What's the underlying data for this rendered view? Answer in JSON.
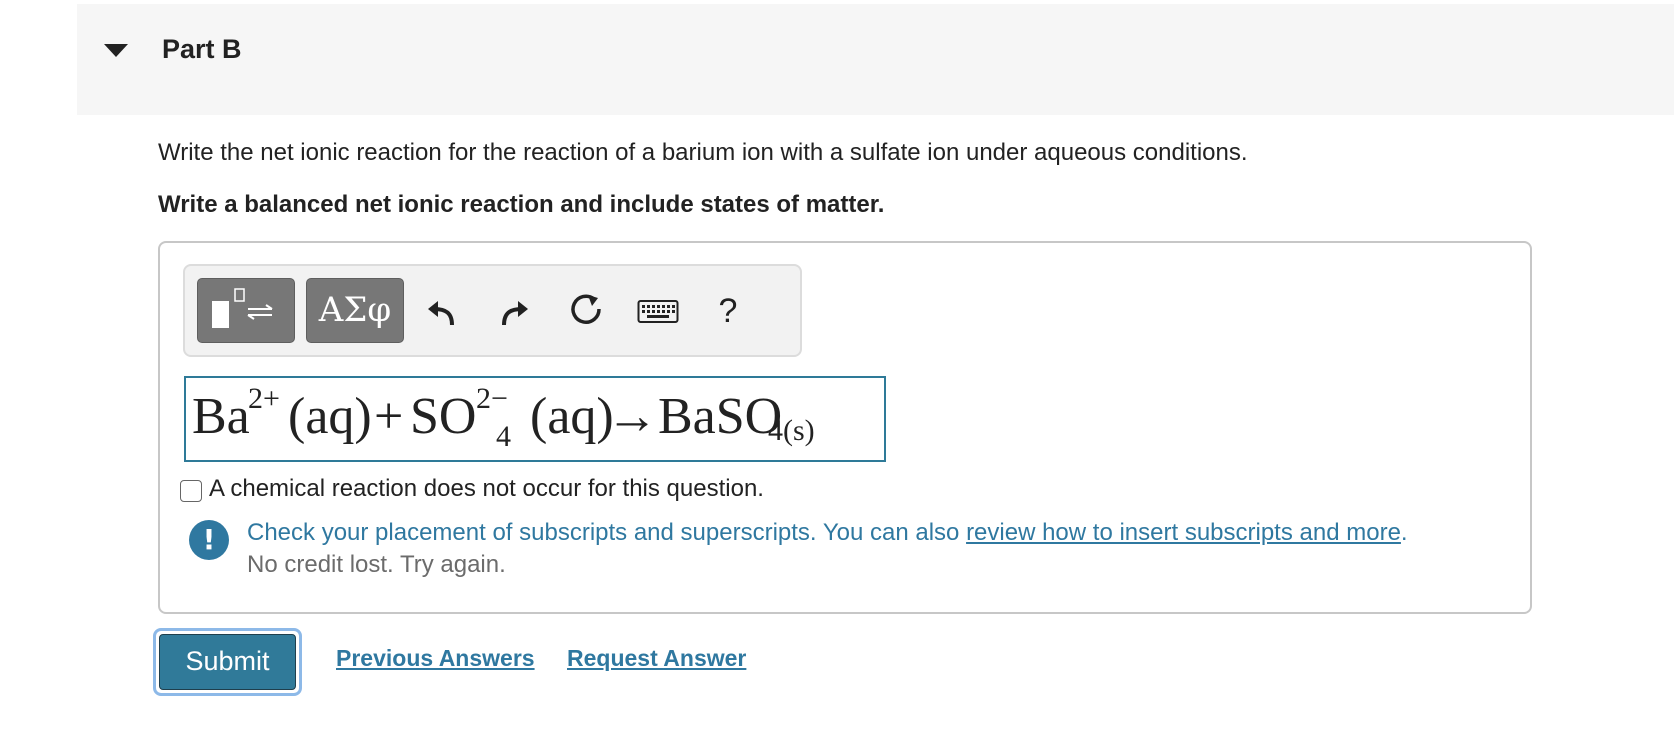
{
  "part": {
    "title": "Part B"
  },
  "question": {
    "prompt": "Write the net ionic reaction for the reaction of a barium ion with a sulfate ion under aqueous conditions.",
    "instruction": "Write a balanced net ionic reaction and include states of matter."
  },
  "toolbar": {
    "greek_label": "ΑΣφ",
    "help_label": "?"
  },
  "answer": {
    "equation": {
      "ba": "Ba",
      "ba_charge": "2+",
      "aq1": "(aq)",
      "plus": "+",
      "so": "SO",
      "so_charge": "2−",
      "so_sub": "4",
      "aq2": "(aq)",
      "arrow": "→",
      "product": "BaSO",
      "product_sub": "4(s)"
    }
  },
  "no_reaction": {
    "label": "A chemical reaction does not occur for this question."
  },
  "feedback": {
    "message": "Check your placement of subscripts and superscripts. You can also ",
    "link_text": "review how to insert subscripts and more",
    "message_end": ".",
    "subtext": "No credit lost. Try again."
  },
  "actions": {
    "submit_label": "Submit",
    "previous_answers_label": "Previous Answers",
    "request_answer_label": "Request Answer"
  },
  "colors": {
    "accent": "#2f78a0",
    "submit_bg": "#307a99",
    "header_bg": "#f6f6f6"
  }
}
